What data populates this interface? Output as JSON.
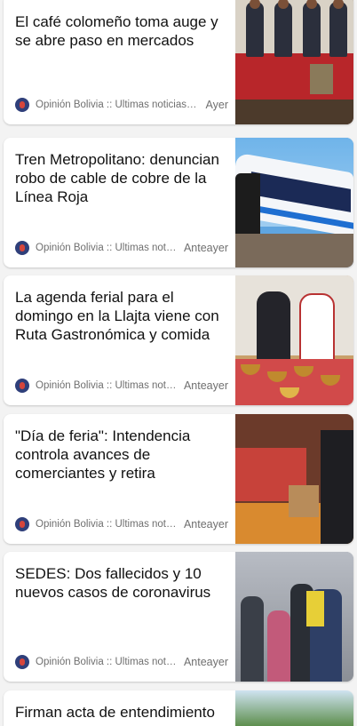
{
  "feed": {
    "items": [
      {
        "headline": "El café colomeño  toma auge y se abre paso en mercados",
        "source": "Opinión Bolivia :: Últimas noticias -...",
        "time": "Ayer"
      },
      {
        "headline": "Tren Metropolitano: denuncian robo de cable de cobre de la Línea Roja",
        "source": "Opinión Bolivia :: Últimas notici...",
        "time": "Anteayer"
      },
      {
        "headline": "La agenda ferial para el domingo en la Llajta viene con Ruta Gastronómica y comida",
        "source": "Opinión Bolivia :: Últimas notici...",
        "time": "Anteayer"
      },
      {
        "headline": "\"Día de feria\": Intendencia controla avances de comerciantes y retira",
        "source": "Opinión Bolivia :: Últimas notici...",
        "time": "Anteayer"
      },
      {
        "headline": "SEDES: Dos fallecidos y 10 nuevos casos de coronavirus",
        "source": "Opinión Bolivia :: Últimas notici...",
        "time": "Anteayer"
      },
      {
        "headline": "Firman acta de entendimiento"
      }
    ]
  },
  "colors": {
    "background": "#f3f3f3",
    "card": "#ffffff",
    "headline": "#111111",
    "meta": "#6f6f6f",
    "source_icon": "#2f3f7a"
  }
}
